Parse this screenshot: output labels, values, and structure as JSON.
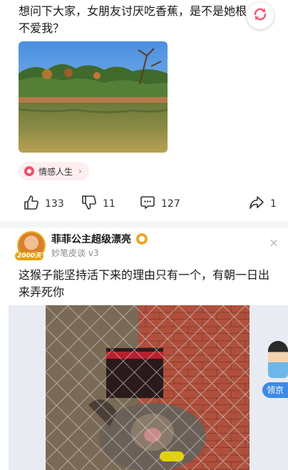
{
  "post1": {
    "text": "想问下大家，女朋友讨厌吃香蕉，是不是她根不爱我？",
    "tag_label": "情感人生",
    "tag_chevron": "›",
    "likes": "133",
    "dislikes": "11",
    "comments": "127",
    "shares": "1"
  },
  "post2": {
    "username": "菲菲公主超级漂亮",
    "subtitle": "妙笔皮谈 v3",
    "avatar_badge": "2000天",
    "close_glyph": "×",
    "text": "这猴子能坚持活下来的理由只有一个，有朝一日出来弄死你"
  },
  "promo": {
    "label": "领京"
  },
  "icons": {
    "refresh": "refresh-icon",
    "like": "thumbs-up-icon",
    "dislike": "thumbs-down-icon",
    "comment": "comment-icon",
    "share": "share-icon",
    "verified": "verified-badge-icon"
  },
  "colors": {
    "tag_bg": "#fdeef0",
    "tag_accent": "#f0506e",
    "refresh_accent": "#f15b7c",
    "promo_blue": "#3e8ae6",
    "badge_gold": "#e6a10f"
  }
}
